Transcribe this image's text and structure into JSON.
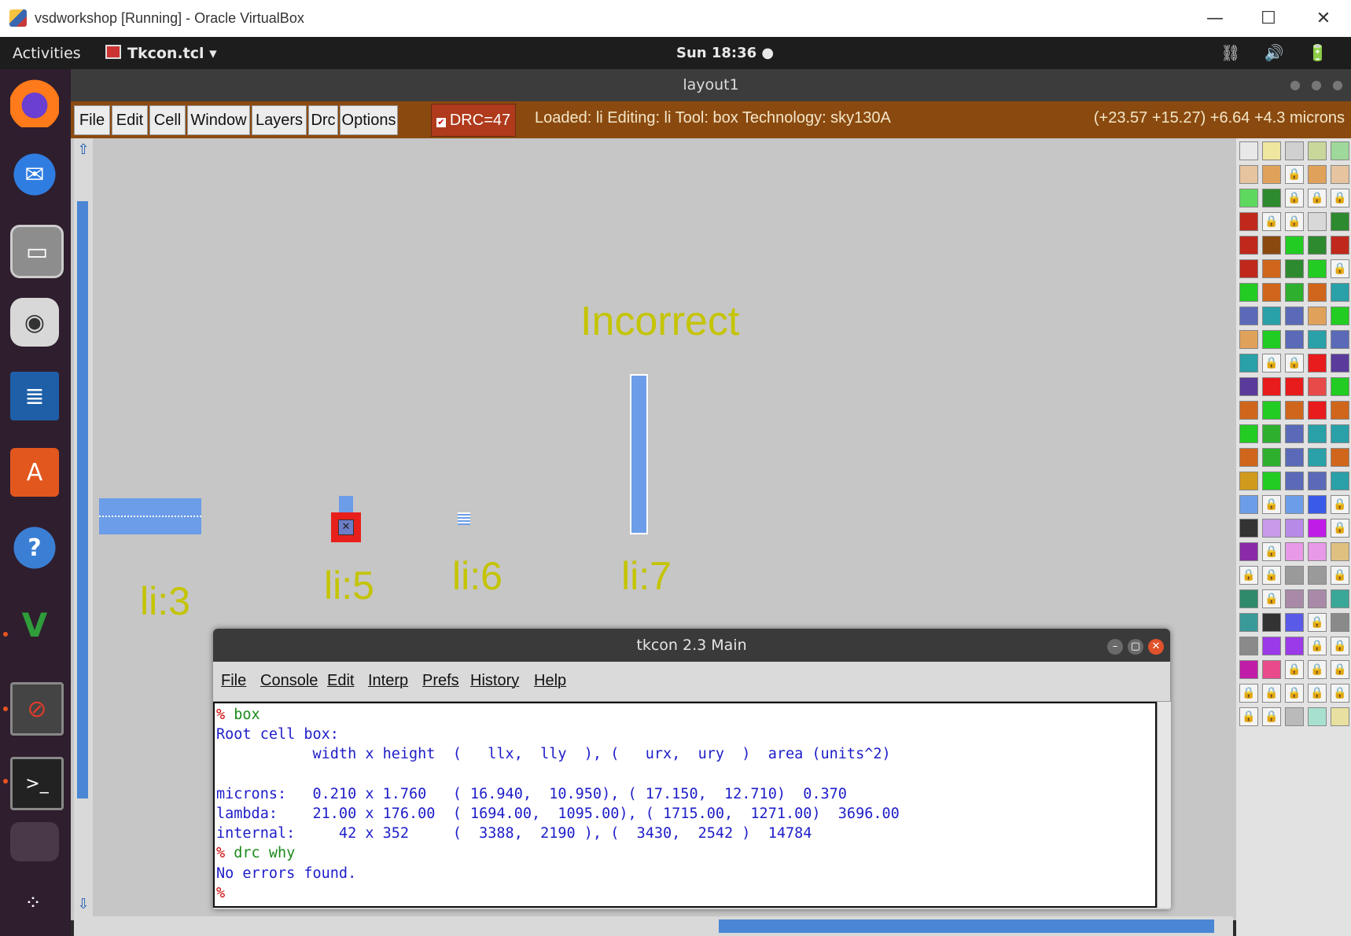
{
  "vbox": {
    "title": "vsdworkshop [Running] - Oracle VirtualBox",
    "min": "—",
    "max": "☐",
    "close": "✕"
  },
  "topbar": {
    "activities": "Activities",
    "app": "Tkcon.tcl ▾",
    "clock": "Sun 18:36 ●",
    "tray": "⛓ 🔊 🔋"
  },
  "dock": {
    "items": [
      "firefox-icon",
      "thunderbird-icon",
      "files-icon",
      "rhythmbox-icon",
      "writer-icon",
      "software-icon",
      "help-icon",
      "vim-icon",
      "stop-icon",
      "terminal-icon",
      "app-icon",
      "grid-icon"
    ]
  },
  "magic": {
    "title": "layout1",
    "menu": [
      "File",
      "Edit",
      "Cell",
      "Window",
      "Layers",
      "Drc",
      "Options"
    ],
    "drc": "DRC=47",
    "status": "Loaded: li Editing: li Tool: box  Technology: sky130A",
    "coords": "(+23.57 +15.27) +6.64 +4.3 microns"
  },
  "canvas": {
    "incorrect": "Incorrect",
    "labels": [
      "li:3",
      "li:5",
      "li:6",
      "li:7"
    ]
  },
  "tkcon": {
    "title": "tkcon 2.3 Main",
    "menu": [
      "File",
      "Console",
      "Edit",
      "Interp",
      "Prefs",
      "History",
      "Help"
    ],
    "lines": [
      {
        "prompt": "% ",
        "cmd": "box"
      },
      {
        "text": "Root cell box:"
      },
      {
        "text": "           width x height  (   llx,  lly  ), (   urx,  ury  )  area (units^2)"
      },
      {
        "text": ""
      },
      {
        "text": "microns:   0.210 x 1.760   ( 16.940,  10.950), ( 17.150,  12.710)  0.370"
      },
      {
        "text": "lambda:    21.00 x 176.00  ( 1694.00,  1095.00), ( 1715.00,  1271.00)  3696.00"
      },
      {
        "text": "internal:     42 x 352     (  3388,  2190 ), (  3430,  2542 )  14784"
      },
      {
        "prompt": "% ",
        "cmd": "drc why"
      },
      {
        "text": "No errors found."
      },
      {
        "prompt": "%",
        "cmd": ""
      }
    ]
  }
}
